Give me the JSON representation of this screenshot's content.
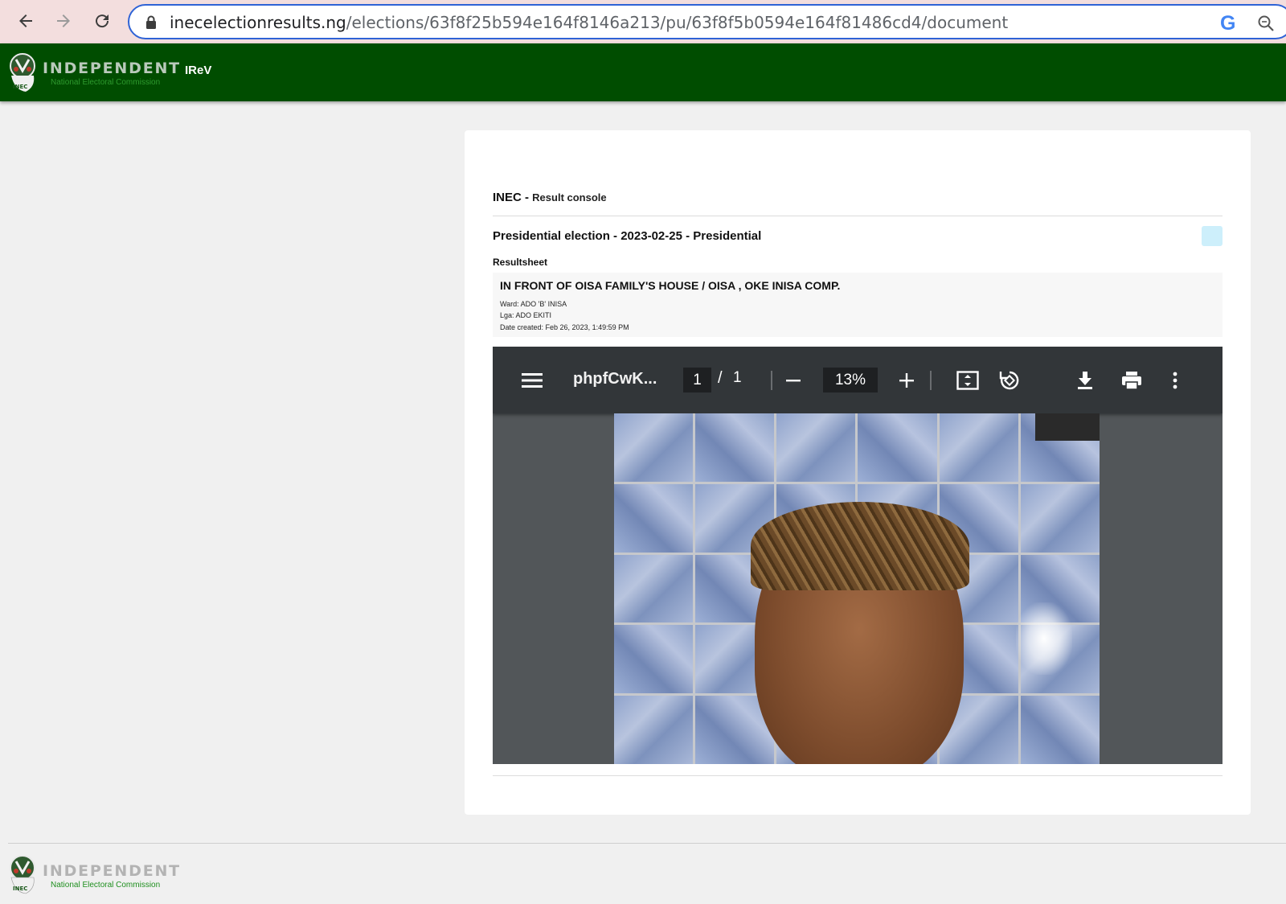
{
  "browser": {
    "url_host": "inecelectionresults.ng",
    "url_path": "/elections/63f8f25b594e164f8146a213/pu/63f8f5b0594e164f81486cd4/document"
  },
  "header": {
    "brand": "INDEPENDENT",
    "brand_sub": "National Electoral Commission",
    "nav_item": "IReV"
  },
  "console": {
    "title": "INEC - ",
    "subtitle": "Result console"
  },
  "election": {
    "title": "Presidential election - 2023-02-25 - Presidential",
    "section_label": "Resultsheet"
  },
  "polling_unit": {
    "name": "IN FRONT OF OISA FAMILY'S HOUSE / OISA , OKE INISA COMP.",
    "ward": "Ward: ADO 'B' INISA",
    "lga": "Lga: ADO EKITI",
    "date_created": "Date created: Feb 26, 2023, 1:49:59 PM"
  },
  "pdf": {
    "doc_name": "phpfCwK...",
    "page_current": "1",
    "page_sep": "/",
    "page_total": "1",
    "zoom": "13%"
  },
  "footer": {
    "brand": "INDEPENDENT",
    "brand_sub": "National Electoral Commission"
  },
  "colors": {
    "header_green": "#004d00",
    "address_border": "#2f63d6",
    "pdf_toolbar": "#323639",
    "pdf_background": "#525659",
    "badge": "#cdeffb"
  }
}
